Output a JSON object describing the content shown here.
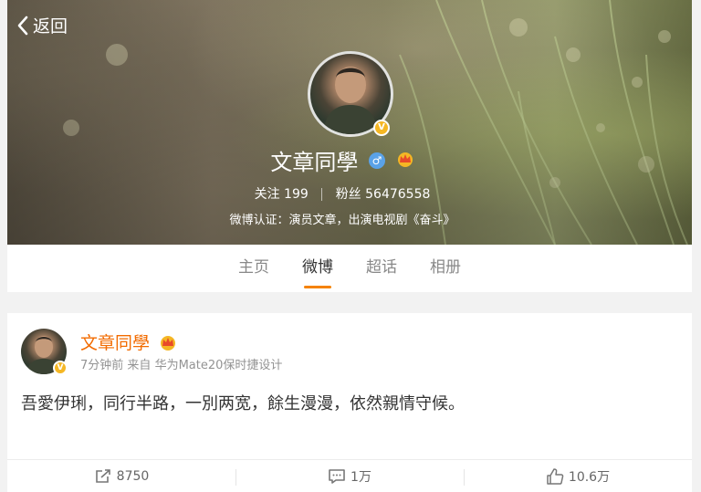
{
  "header": {
    "back_label": "返回"
  },
  "profile": {
    "name": "文章同學",
    "follow_label": "关注",
    "follow_count": "199",
    "fans_label": "粉丝",
    "fans_count": "56476558",
    "verify_text": "微博认证：演员文章，出演电视剧《奋斗》",
    "gender_symbol": "♂"
  },
  "tabs": [
    {
      "label": "主页"
    },
    {
      "label": "微博"
    },
    {
      "label": "超话"
    },
    {
      "label": "相册"
    }
  ],
  "active_tab": "微博",
  "post": {
    "author": "文章同學",
    "time": "7分钟前",
    "source_prefix": "来自",
    "source": "华为Mate20保时捷设计",
    "text": "吾愛伊琍，同行半路，一別两宽，餘生漫漫，依然親情守候。",
    "reposts": "8750",
    "comments": "1万",
    "likes": "10.6万"
  },
  "colors": {
    "accent": "#f58200",
    "name": "#f26b00",
    "verified_badge": "#f5b724",
    "gender_badge": "#5aa2e8"
  },
  "icons": [
    "chevron-left-icon",
    "verified-icon",
    "male-icon",
    "crown-icon",
    "repost-icon",
    "comment-icon",
    "like-icon"
  ]
}
